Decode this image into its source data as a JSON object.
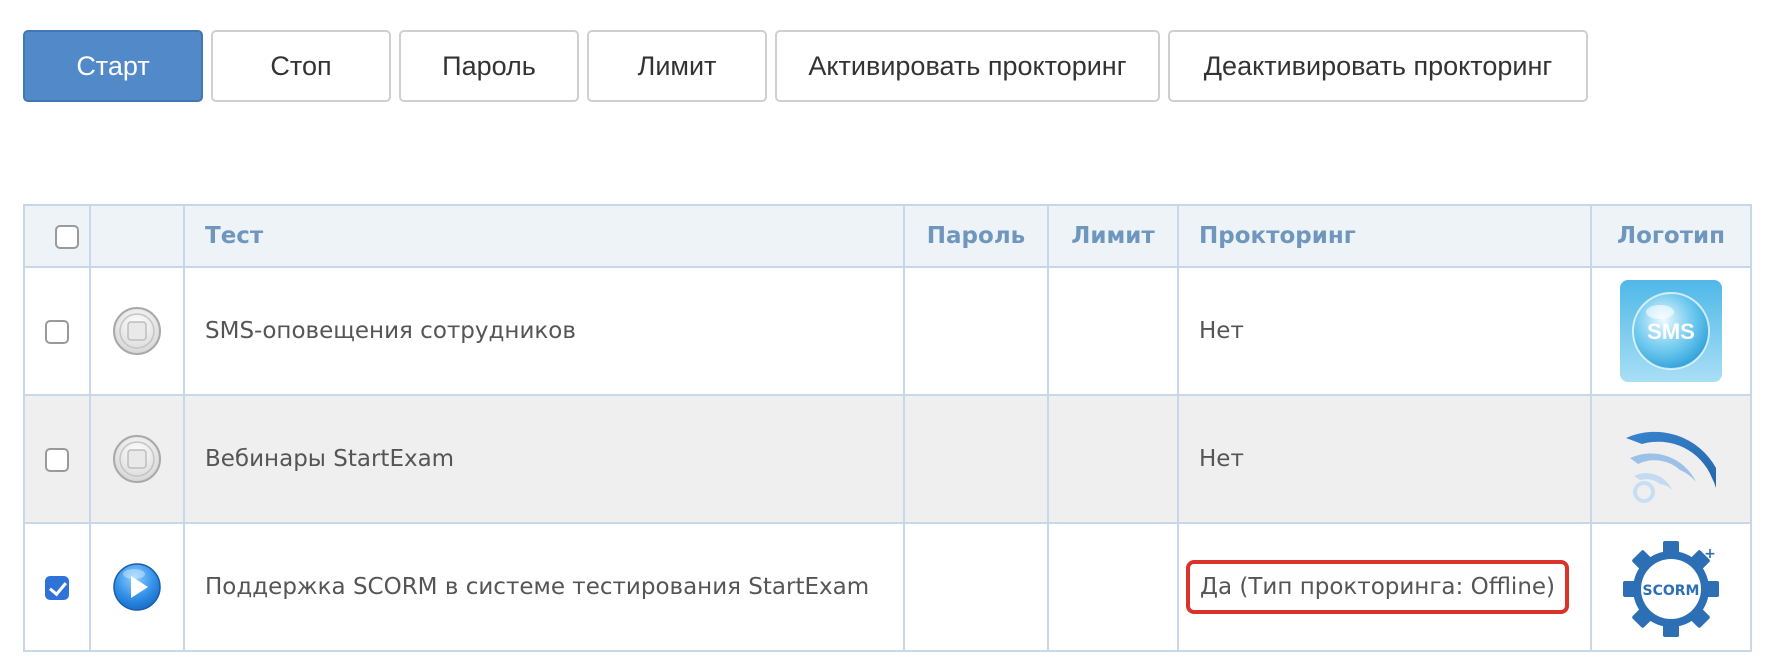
{
  "toolbar": {
    "start": "Старт",
    "stop": "Стоп",
    "password": "Пароль",
    "limit": "Лимит",
    "activate": "Активировать прокторинг",
    "deactivate": "Деактивировать прокторинг"
  },
  "table": {
    "headers": {
      "test": "Тест",
      "password": "Пароль",
      "limit": "Лимит",
      "proctoring": "Прокторинг",
      "logo": "Логотип"
    },
    "rows": [
      {
        "checked": false,
        "status_icon": "stopped-icon",
        "name": "SMS-оповещения сотрудников",
        "password": "",
        "limit": "",
        "proctoring": "Нет",
        "logo": "sms-logo",
        "logo_text": "SMS"
      },
      {
        "checked": false,
        "status_icon": "stopped-icon",
        "name": "Вебинары StartExam",
        "password": "",
        "limit": "",
        "proctoring": "Нет",
        "logo": "webinar-logo"
      },
      {
        "checked": true,
        "status_icon": "play-icon",
        "name": "Поддержка SCORM в системе тестирования StartExam",
        "password": "",
        "limit": "",
        "proctoring": "Да (Тип прокторинга: Offline)",
        "logo": "scorm-logo",
        "logo_text": "SCORM"
      }
    ]
  },
  "colors": {
    "primary": "#5289c9",
    "header_text": "#6f97bd",
    "highlight": "#d9342b",
    "checkbox_checked": "#2f73d8"
  }
}
